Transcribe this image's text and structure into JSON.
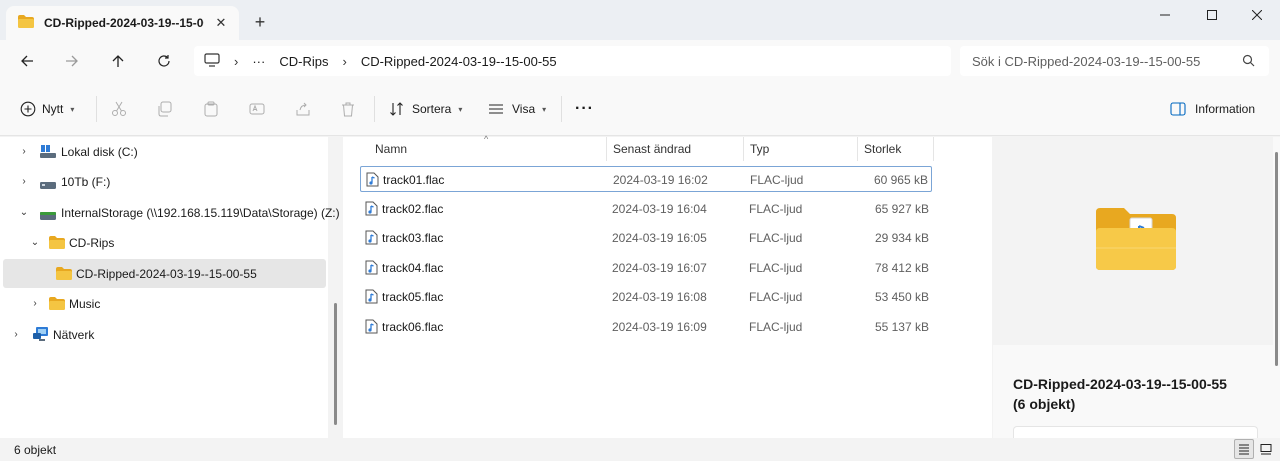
{
  "tab": {
    "title": "CD-Ripped-2024-03-19--15-00"
  },
  "address": {
    "crumbs": [
      "CD-Rips",
      "CD-Ripped-2024-03-19--15-00-55"
    ],
    "more": "···"
  },
  "search": {
    "placeholder": "Sök i CD-Ripped-2024-03-19--15-00-55"
  },
  "toolbar": {
    "new_label": "Nytt",
    "sort_label": "Sortera",
    "view_label": "Visa",
    "more_label": "···",
    "info_label": "Information"
  },
  "sidebar": {
    "items": [
      {
        "label": "Lokal disk (C:)"
      },
      {
        "label": "10Tb (F:)"
      },
      {
        "label": "InternalStorage (\\\\192.168.15.119\\Data\\Storage) (Z:)"
      },
      {
        "label": "CD-Rips"
      },
      {
        "label": "CD-Ripped-2024-03-19--15-00-55"
      },
      {
        "label": "Music"
      },
      {
        "label": "Nätverk"
      }
    ]
  },
  "columns": {
    "name": "Namn",
    "date": "Senast ändrad",
    "type": "Typ",
    "size": "Storlek"
  },
  "files": [
    {
      "name": "track01.flac",
      "date": "2024-03-19 16:02",
      "type": "FLAC-ljud",
      "size": "60 965 kB"
    },
    {
      "name": "track02.flac",
      "date": "2024-03-19 16:04",
      "type": "FLAC-ljud",
      "size": "65 927 kB"
    },
    {
      "name": "track03.flac",
      "date": "2024-03-19 16:05",
      "type": "FLAC-ljud",
      "size": "29 934 kB"
    },
    {
      "name": "track04.flac",
      "date": "2024-03-19 16:07",
      "type": "FLAC-ljud",
      "size": "78 412 kB"
    },
    {
      "name": "track05.flac",
      "date": "2024-03-19 16:08",
      "type": "FLAC-ljud",
      "size": "53 450 kB"
    },
    {
      "name": "track06.flac",
      "date": "2024-03-19 16:09",
      "type": "FLAC-ljud",
      "size": "55 137 kB"
    }
  ],
  "details": {
    "title": "CD-Ripped-2024-03-19--15-00-55",
    "subtitle": "(6 objekt)"
  },
  "status": {
    "count": "6 objekt"
  },
  "colors": {
    "folder": "#f4c542",
    "folder_dark": "#e8a820",
    "accent": "#0067c0",
    "selected": "#e6e6e6"
  }
}
